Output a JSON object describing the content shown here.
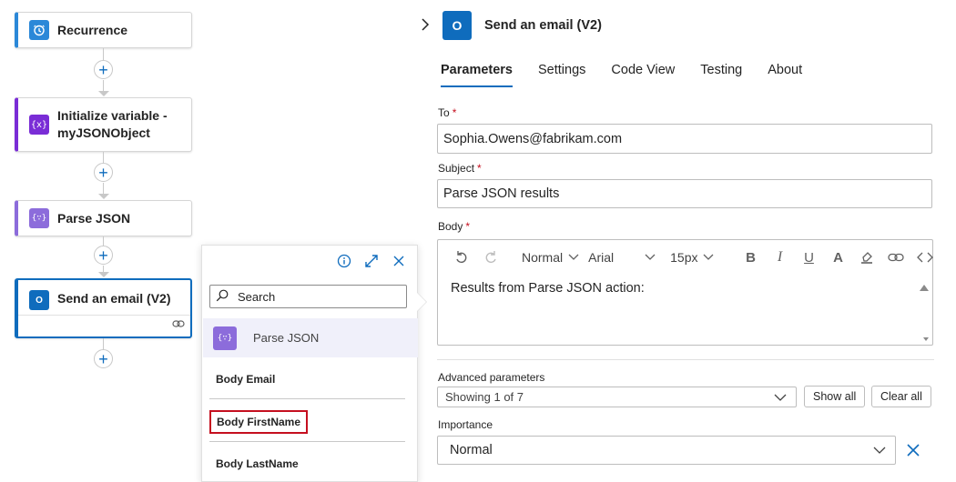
{
  "canvas": {
    "nodes": [
      {
        "title": "Recurrence",
        "icon": "clock-icon",
        "color": "#2b88d8"
      },
      {
        "title": "Initialize variable - myJSONObject",
        "icon": "variable-icon",
        "color": "#7a2dd6"
      },
      {
        "title": "Parse JSON",
        "icon": "parse-json-icon",
        "color": "#8c6cdb"
      },
      {
        "title": "Send an email (V2)",
        "icon": "outlook-icon",
        "color": "#0f6cbd"
      }
    ]
  },
  "popup": {
    "search_placeholder": "Search",
    "group_label": "Parse JSON",
    "items": [
      "Body Email",
      "Body FirstName",
      "Body LastName"
    ],
    "highlight_color": "#c50f1f"
  },
  "panel": {
    "title": "Send an email (V2)",
    "tabs": [
      "Parameters",
      "Settings",
      "Code View",
      "Testing",
      "About"
    ],
    "to_label": "To",
    "to_value": "Sophia.Owens@fabrikam.com",
    "subject_label": "Subject",
    "subject_value": "Parse JSON results",
    "body_label": "Body",
    "toolbar": {
      "style": "Normal",
      "font": "Arial",
      "size": "15px"
    },
    "body_text": "Results from Parse JSON action:",
    "advanced_label": "Advanced parameters",
    "advanced_value": "Showing 1 of 7",
    "show_all": "Show all",
    "clear_all": "Clear all",
    "importance_label": "Importance",
    "importance_value": "Normal",
    "required_marker": "*",
    "accent_color": "#0f6cbd"
  }
}
